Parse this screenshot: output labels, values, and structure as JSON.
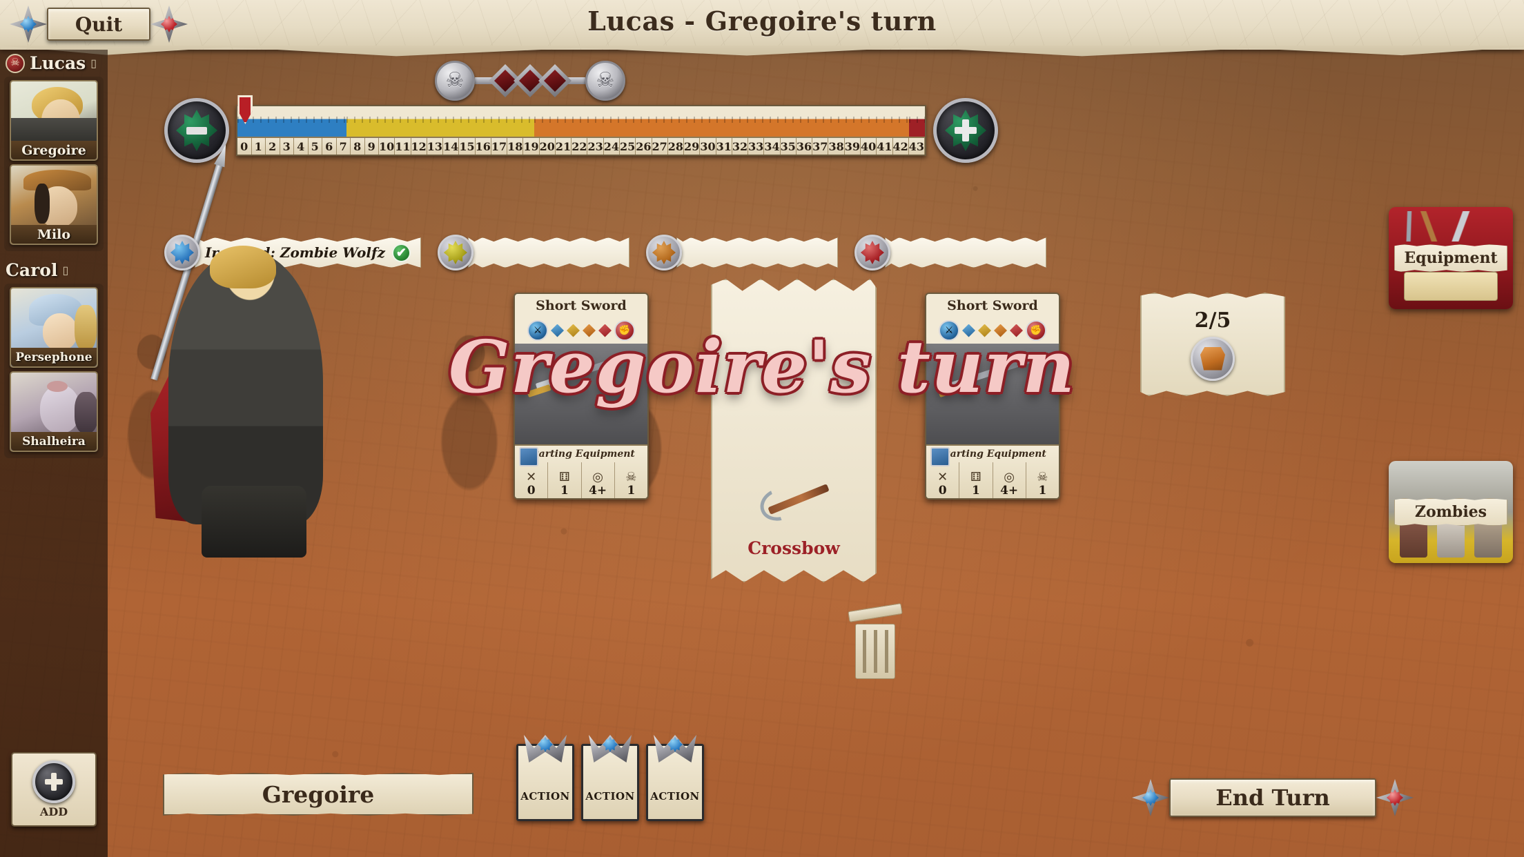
{
  "window": {
    "title": "Lucas - Gregoire's turn"
  },
  "top_bar": {
    "quit_label": "Quit"
  },
  "overlay": {
    "turn_announcement": "Gregoire's turn"
  },
  "sidebar": {
    "players": [
      {
        "name": "Lucas",
        "badge_icon": "skull-badge-icon",
        "note": "▯",
        "characters": [
          {
            "name": "Gregoire",
            "portrait": "portrait-greg"
          },
          {
            "name": "Milo",
            "portrait": "portrait-milo"
          }
        ]
      },
      {
        "name": "Carol",
        "badge_icon": "",
        "note": "▯",
        "characters": [
          {
            "name": "Persephone",
            "portrait": "portrait-pers"
          },
          {
            "name": "Shalheira",
            "portrait": "portrait-shal"
          }
        ]
      }
    ],
    "add_button": {
      "label": "ADD",
      "icon": "plus-medallion-icon"
    }
  },
  "danger_track": {
    "left_icon": "skull-coin-icon",
    "right_icon": "skull-coin-icon",
    "nodes": 3
  },
  "xp_track": {
    "minus_button": {
      "icon": "minus-clover-icon",
      "label": "-"
    },
    "plus_button": {
      "icon": "plus-clover-icon",
      "label": "+"
    },
    "marker_position": 0,
    "cells": [
      "0",
      "1",
      "2",
      "3",
      "4",
      "5",
      "6",
      "7",
      "8",
      "9",
      "10",
      "11",
      "12",
      "13",
      "14",
      "15",
      "16",
      "17",
      "18",
      "19",
      "20",
      "21",
      "22",
      "23",
      "24",
      "25",
      "26",
      "27",
      "28",
      "29",
      "30",
      "31",
      "32",
      "33",
      "34",
      "35",
      "36",
      "37",
      "38",
      "39",
      "40",
      "41",
      "42",
      "43"
    ],
    "zones": [
      {
        "color_name": "blue",
        "start": 0,
        "end": 6
      },
      {
        "color_name": "yellow",
        "start": 7,
        "end": 18
      },
      {
        "color_name": "orange",
        "start": 19,
        "end": 42
      },
      {
        "color_name": "red",
        "start": 43,
        "end": 43
      }
    ]
  },
  "skills": [
    {
      "color": "blue",
      "text": "Ironclad: Zombie Wolfz",
      "checked": true,
      "check_glyph": "✔"
    },
    {
      "color": "yellow",
      "text": "",
      "checked": false,
      "check_glyph": ""
    },
    {
      "color": "orange",
      "text": "",
      "checked": false,
      "check_glyph": ""
    },
    {
      "color": "red",
      "text": "",
      "checked": false,
      "check_glyph": ""
    }
  ],
  "equipment_cards": [
    {
      "name": "Short Sword",
      "left_icon": "crossed-swords-icon",
      "right_icon": "fist-icon",
      "diamonds": [
        "blue",
        "gold",
        "orange",
        "red"
      ],
      "footer_label": "Starting Equipment",
      "stats": [
        {
          "glyph": "✕",
          "icon_name": "range-icon",
          "value": "0"
        },
        {
          "glyph": "⚅",
          "icon_name": "dice-icon",
          "value": "1"
        },
        {
          "glyph": "◎",
          "icon_name": "target-icon",
          "value": "4+"
        },
        {
          "glyph": "☠",
          "icon_name": "damage-skull-icon",
          "value": "1"
        }
      ]
    },
    {
      "name": "Short Sword",
      "left_icon": "crossed-swords-icon",
      "right_icon": "fist-icon",
      "diamonds": [
        "blue",
        "gold",
        "orange",
        "red"
      ],
      "footer_label": "Starting Equipment",
      "stats": [
        {
          "glyph": "✕",
          "icon_name": "range-icon",
          "value": "0"
        },
        {
          "glyph": "⚅",
          "icon_name": "dice-icon",
          "value": "1"
        },
        {
          "glyph": "◎",
          "icon_name": "target-icon",
          "value": "4+"
        },
        {
          "glyph": "☠",
          "icon_name": "damage-skull-icon",
          "value": "1"
        }
      ]
    }
  ],
  "center_item": {
    "label": "Crossbow",
    "icon": "crossbow-icon"
  },
  "backpack": {
    "count_label": "2/5",
    "icon": "backpack-icon"
  },
  "discard": {
    "icon": "discard-pile-icon"
  },
  "bottom": {
    "active_character": "Gregoire",
    "action_cards": [
      {
        "label": "ACTION",
        "icon": "blue-clover-crest-icon"
      },
      {
        "label": "ACTION",
        "icon": "blue-clover-crest-icon"
      },
      {
        "label": "ACTION",
        "icon": "blue-clover-crest-icon"
      }
    ],
    "end_turn_label": "End Turn"
  },
  "side_tabs": [
    {
      "label": "Equipment",
      "id": "tab-equipment"
    },
    {
      "label": "Zombies",
      "id": "tab-zombies"
    }
  ],
  "colors": {
    "parchment": "#efe6d2",
    "ink": "#3a2a1b",
    "accent_red": "#9c2127",
    "clover_blue": "#2a76bd",
    "clover_yellow": "#a8a019",
    "clover_orange": "#b46a1d",
    "clover_red": "#a72025",
    "clover_green": "#14613a"
  }
}
